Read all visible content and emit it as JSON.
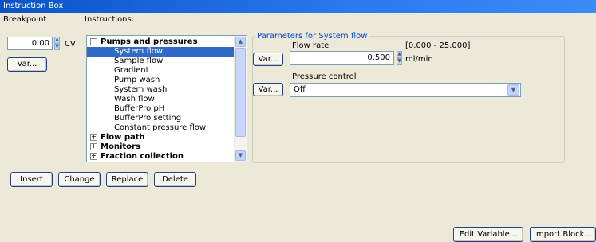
{
  "window": {
    "title": "Instruction Box"
  },
  "breakpoint": {
    "label": "Breakpoint",
    "value": "0.00",
    "unit": "CV",
    "var_button": "Var..."
  },
  "instructions": {
    "label": "Instructions:",
    "groups": [
      {
        "label": "Pumps and pressures",
        "expander": "−",
        "items": [
          "System flow",
          "Sample flow",
          "Gradient",
          "Pump wash",
          "System wash",
          "Wash flow",
          "BufferPro pH",
          "BufferPro setting",
          "Constant pressure flow"
        ]
      },
      {
        "label": "Flow path",
        "expander": "+"
      },
      {
        "label": "Monitors",
        "expander": "+"
      },
      {
        "label": "Fraction collection",
        "expander": "+"
      }
    ],
    "selected_item": "System flow"
  },
  "parameters": {
    "title": "Parameters for System flow",
    "flow_rate": {
      "label": "Flow rate",
      "range": "[0.000 - 25.000]",
      "value": "0.500",
      "unit": "ml/min",
      "var_button": "Var..."
    },
    "pressure_control": {
      "label": "Pressure control",
      "value": "Off",
      "var_button": "Var..."
    }
  },
  "actions": {
    "insert": "Insert",
    "change": "Change",
    "replace": "Replace",
    "delete": "Delete"
  },
  "footer": {
    "edit_variable": "Edit Variable...",
    "import_block": "Import Block..."
  },
  "colors": {
    "selection": "#316ac5",
    "title_bar": "#0a53c8",
    "group_title": "#0046d5"
  },
  "icons": {
    "spin_up": "▲",
    "spin_down": "▼",
    "scroll_up": "▲",
    "scroll_down": "▼",
    "dropdown": "▼"
  }
}
